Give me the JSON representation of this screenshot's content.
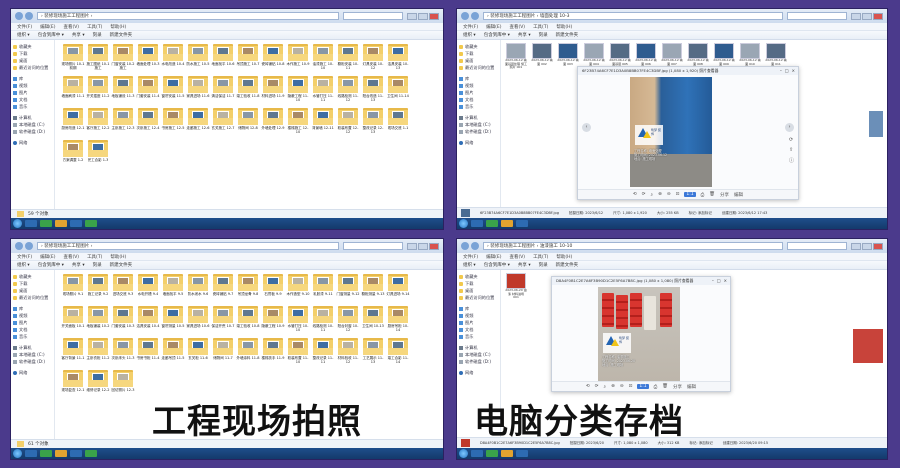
{
  "colors": {
    "background": "#4b3a8c",
    "folder": "#f3cf6a",
    "accent": "#3b78d8"
  },
  "captions": {
    "left": "工程现场拍照",
    "right": "电脑分类存档"
  },
  "explorer": {
    "address": "› 装修现场施工工程图片 ›",
    "menu": [
      "文件(F)",
      "编辑(E)",
      "查看(V)",
      "工具(T)",
      "帮助(H)"
    ],
    "toolbar": [
      "组织 ▾",
      "包含到库中 ▾",
      "共享 ▾",
      "刻录",
      "新建文件夹"
    ],
    "sidebar": [
      {
        "icon": "star",
        "label": "收藏夹"
      },
      {
        "icon": "star",
        "label": "下载"
      },
      {
        "icon": "star",
        "label": "桌面"
      },
      {
        "icon": "star",
        "label": "最近访问的位置"
      },
      {
        "gap": true
      },
      {
        "icon": "lib",
        "label": "库"
      },
      {
        "icon": "lib",
        "label": "视频"
      },
      {
        "icon": "lib",
        "label": "图片"
      },
      {
        "icon": "lib",
        "label": "文档"
      },
      {
        "icon": "lib",
        "label": "音乐"
      },
      {
        "gap": true
      },
      {
        "icon": "pc",
        "label": "计算机"
      },
      {
        "icon": "drv",
        "label": "本地磁盘 (C:)"
      },
      {
        "icon": "drv",
        "label": "软件磁盘 (D:)"
      },
      {
        "gap": true
      },
      {
        "icon": "net",
        "label": "网络"
      }
    ],
    "status_top": "59 个对象",
    "status_bottom": "61 个对象",
    "folders_top": [
      "现场照片 10-1 前期",
      "施工图纸 10-1 施工",
      "门窗安装 10-2 施工",
      "墙面处理 10-3",
      "水电改造 10-4",
      "防水施工 10-5",
      "地面找平 10-6",
      "吊顶施工 10-7",
      "瓷砖铺贴 10-8",
      "木作施工 10-9",
      "油漆施工 10-10",
      "橱柜安装 10-11",
      "灯具安装 10-12",
      "洁具安装 10-13",
      "墙面刷漆 11-1",
      "开关插座 11-2",
      "地板铺设 11-3",
      "门套安装 11-4",
      "窗帘安装 11-5",
      "家具进场 11-6",
      "清洁保洁 11-7",
      "竣工验收 11-8",
      "材料进场 11-9",
      "隐蔽工程 11-10",
      "水管打压 11-11",
      "线路检测 11-12",
      "阳台改造 11-13",
      "卫生间 11-14",
      "厨房改造 12-1",
      "客厅施工 12-2",
      "主卧施工 12-3",
      "次卧施工 12-4",
      "书房施工 12-5",
      "走廊施工 12-6",
      "玄关施工 12-7",
      "储物间 12-8",
      "外墙处理 12-9",
      "楼梯施工 12-10",
      "背景墙 12-11",
      "软装布置 12-12",
      "整改记录 12-13",
      "现场交底 1-1",
      "方案调整 1-2",
      "完工合影 1-3"
    ],
    "folders_bottom": [
      "现场照片 9-1",
      "施工记录 9-2",
      "进场交底 9-3",
      "水电开槽 9-4",
      "墙面找平 9-5",
      "防水闭水 9-6",
      "瓷砖铺贴 9-7",
      "吊顶龙骨 9-8",
      "石膏板 9-9",
      "木作造型 9-10",
      "乳胶漆 9-11",
      "门窗测量 9-12",
      "橱柜测量 9-13",
      "灯具进场 9-14",
      "开关面板 10-1",
      "地板铺装 10-2",
      "门套安装 10-3",
      "洁具安装 10-4",
      "窗帘测量 10-5",
      "家具进场 10-6",
      "保洁开荒 10-7",
      "竣工验收 10-8",
      "隐蔽工程 10-9",
      "水管打压 10-10",
      "线路检测 10-11",
      "阳台封窗 10-12",
      "卫生间 10-13",
      "厨房吊柜 10-14",
      "客厅背景 11-1",
      "主卧衣柜 11-2",
      "次卧床头 11-3",
      "书房书柜 11-4",
      "走廊吊顶 11-5",
      "玄关柜 11-6",
      "储物间 11-7",
      "外墙涂料 11-8",
      "楼梯扶手 11-9",
      "软装布置 11-10",
      "整改记录 11-11",
      "材料验收 11-12",
      "工艺展示 11-13",
      "竣工合影 11-14",
      "现场复查 12-1",
      "维修记录 12-2",
      "回访照片 12-3"
    ]
  },
  "viewer_top": {
    "address": "› 装修现场施工工程图片 › 墙面处理 10-3",
    "thumbs": [
      "2023-06-12 墙面基层处理 施工照片 001",
      "2023-06-12 墙面 002",
      "2023-06-12 墙面 003",
      "2023-06-12 墙面 004",
      "2023-06-12 墙面基层 005",
      "2023-06-12 墙面 006",
      "2023-06-12 墙面 007",
      "2023-06-12 墙面 008",
      "2023-06-12 墙面 009",
      "2023-06-12 墙面 010",
      "2023-06-12 墙面 011"
    ],
    "title": "6F23B74A6CF7E1D3A0B8BB07FE4C3DBF.jpg (1,080 x 1,920) 照片查看器",
    "stamp": "筑梦 装饰",
    "photo_lines": [
      "工程名称: 墙面处理",
      "施工时间: 2023.06.12",
      "地点: 施工现场"
    ],
    "tools": [
      "⟲",
      "⟳",
      "⌕",
      "⊕",
      "⊖",
      "⊡",
      "1:1",
      "⎙",
      "🗑",
      "分享",
      "编辑"
    ],
    "detail": [
      "6F23B74A6CF7E1D3A0B8BB07FE4C3DBF.jpg",
      "拍摄日期: 2023/6/12",
      "尺寸: 1,080 x 1,920",
      "大小: 255 KB",
      "标记: 添加标记",
      "创建日期: 2023/6/12 17:43"
    ]
  },
  "viewer_bottom": {
    "address": "› 装修现场施工工程图片 › 油漆施工 10-10",
    "thumb": "2023-06-20 油漆 材料进场 001",
    "title": "D8A4F0B1C2E7A6F3B90D1C2E5F6A7B8C.jpg (1,080 x 1,080) 照片查看器",
    "stamp": "筑梦 装饰",
    "photo_lines": [
      "工程名称: 油漆施工",
      "施工时间: 2023.06.20",
      "地点: 施工现场"
    ],
    "tools": [
      "⟲",
      "⟳",
      "⌕",
      "⊕",
      "⊖",
      "⊡",
      "1:1",
      "⎙",
      "🗑",
      "分享",
      "编辑"
    ],
    "detail": [
      "D8A4F0B1C2E7A6F3B90D1C2E5F6A7B8C.jpg",
      "拍摄日期: 2023/6/20",
      "尺寸: 1,080 x 1,080",
      "大小: 312 KB",
      "标记: 添加标记",
      "创建日期: 2023/6/20 09:15"
    ]
  }
}
